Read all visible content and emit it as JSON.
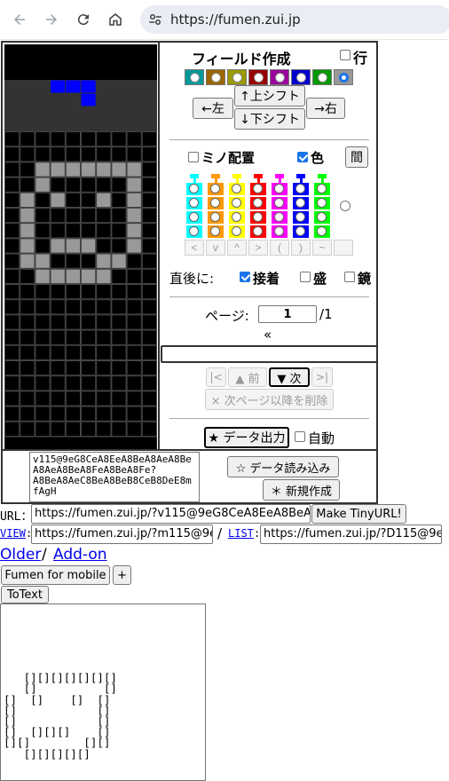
{
  "browser": {
    "url": "https://fumen.zui.jp",
    "back_icon": "back-arrow-icon",
    "forward_icon": "forward-arrow-icon",
    "reload_icon": "reload-icon",
    "home_icon": "home-icon",
    "site_info_icon": "tune-icon"
  },
  "board": {
    "rows": 23,
    "cols": 10,
    "colors": {
      "background": "#000000",
      "hidden_rows_bg": "#333333",
      "grid": "#444444",
      "garbage": "#999999",
      "piece": "#0000ff"
    },
    "next_piece_cells": [
      [
        3,
        2
      ],
      [
        4,
        2
      ],
      [
        5,
        2
      ],
      [
        5,
        3
      ]
    ],
    "field_cells": [
      [
        2,
        8
      ],
      [
        3,
        8
      ],
      [
        4,
        8
      ],
      [
        5,
        8
      ],
      [
        6,
        8
      ],
      [
        7,
        8
      ],
      [
        8,
        8
      ],
      [
        2,
        9
      ],
      [
        8,
        9
      ],
      [
        1,
        10
      ],
      [
        3,
        10
      ],
      [
        6,
        10
      ],
      [
        8,
        10
      ],
      [
        1,
        11
      ],
      [
        8,
        11
      ],
      [
        1,
        12
      ],
      [
        8,
        12
      ],
      [
        1,
        13
      ],
      [
        3,
        13
      ],
      [
        4,
        13
      ],
      [
        5,
        13
      ],
      [
        8,
        13
      ],
      [
        1,
        14
      ],
      [
        2,
        14
      ],
      [
        6,
        14
      ],
      [
        7,
        14
      ],
      [
        2,
        15
      ],
      [
        3,
        15
      ],
      [
        4,
        15
      ],
      [
        5,
        15
      ],
      [
        6,
        15
      ]
    ]
  },
  "panel": {
    "title": "フィールド作成",
    "row_checkbox_label": "行",
    "swatch_colors": [
      "#009999",
      "#996600",
      "#999900",
      "#990000",
      "#990099",
      "#0000cc",
      "#009900",
      "#999999"
    ],
    "shift_up": "↑上シフト",
    "shift_down": "↓下シフト",
    "shift_left": "←左",
    "shift_right": "→右",
    "mino_label": "ミノ配置",
    "color_label": "色",
    "mino_checked": false,
    "color_checked": true,
    "gap_button": "間",
    "palette_colors": [
      "#00ffff",
      "#ff9900",
      "#ffff00",
      "#ff0000",
      "#ff00ff",
      "#0000ff",
      "#00ff00"
    ],
    "arrow_keys": [
      "<",
      "v",
      "^",
      ">",
      "(",
      ")",
      "~",
      ""
    ],
    "after_label": "直後に:",
    "lock_label": "接着",
    "lock_checked": true,
    "rise_label": "盛",
    "mirror_label": "鏡",
    "page_label": "ページ:",
    "page_value": "1",
    "page_total": "/1",
    "double_arrow": "«",
    "comment_value": "",
    "first_button": "|<",
    "prev_button": "▲ 前",
    "next_button": "▼ 次",
    "last_button": ">|",
    "delete_after": "× 次ページ以降を削除",
    "export_button": "★ データ出力",
    "auto_label": "自動"
  },
  "bottom": {
    "data_text": "v115@9eG8CeA8EeA8BeA8AeA8BeA8AeA8BeA8FeA8BeA8Fe?A8BeA8AeC8BeA8BeB8CeB8DeE8mfAgH",
    "load_button": "☆ データ読み込み",
    "new_button": "＊ 新規作成"
  },
  "links": {
    "url_label": "URL：",
    "url_value": "https://fumen.zui.jp/?v115@9eG8CeA8EeA8BeA8AeA8BeA8AeA8",
    "tiny_button": "Make TinyURL!",
    "view_label": "VIEW",
    "view_value": "https://fumen.zui.jp/?m115@9eG8CeA8",
    "separator": "/",
    "list_label": "LIST",
    "list_value": "https://fumen.zui.jp/?D115@9eG8CeA8",
    "older": "Older",
    "slash": "/",
    "addon": "Add-on",
    "mobile_button": "Fumen for mobile",
    "plus_button": "+",
    "totext_button": "ToText"
  },
  "ascii_art": "\n\n\n\n\n\n   [][][][][][][]\n   []          []\n[]  []    []  []\n[]            []\n[]            []\n[]  [][][]    []\n[][]        [][]\n   [][][][][]"
}
